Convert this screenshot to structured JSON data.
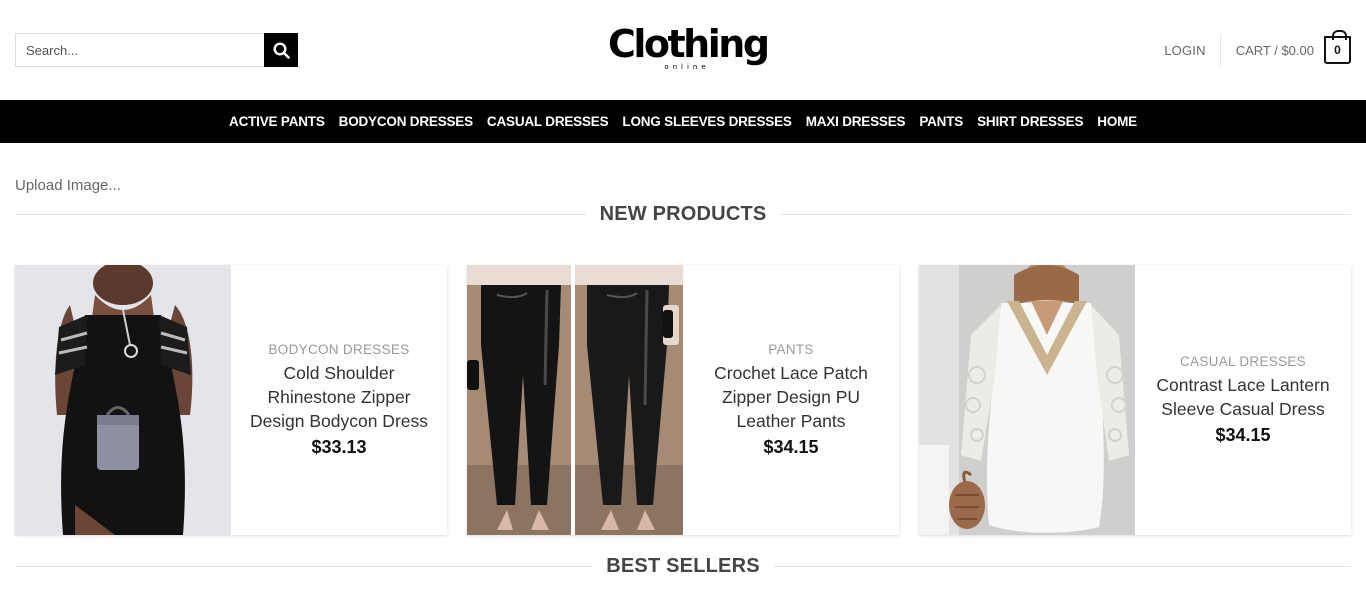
{
  "search": {
    "placeholder": "Search..."
  },
  "logo": {
    "main": "Clothing",
    "sub": "online"
  },
  "header": {
    "login": "LOGIN",
    "cart": "CART / $0.00",
    "cart_count": "0"
  },
  "nav": [
    "ACTIVE PANTS",
    "BODYCON DRESSES",
    "CASUAL DRESSES",
    "LONG SLEEVES DRESSES",
    "MAXI DRESSES",
    "PANTS",
    "SHIRT DRESSES",
    "HOME"
  ],
  "upload_label": "Upload Image...",
  "sections": {
    "new": "NEW PRODUCTS",
    "best": "BEST SELLERS"
  },
  "products": [
    {
      "category": "BODYCON DRESSES",
      "name": "Cold Shoulder Rhinestone Zipper Design Bodycon Dress",
      "price": "$33.13"
    },
    {
      "category": "PANTS",
      "name": "Crochet Lace Patch Zipper Design PU Leather Pants",
      "price": "$34.15"
    },
    {
      "category": "CASUAL DRESSES",
      "name": "Contrast Lace Lantern Sleeve Casual Dress",
      "price": "$34.15"
    }
  ]
}
